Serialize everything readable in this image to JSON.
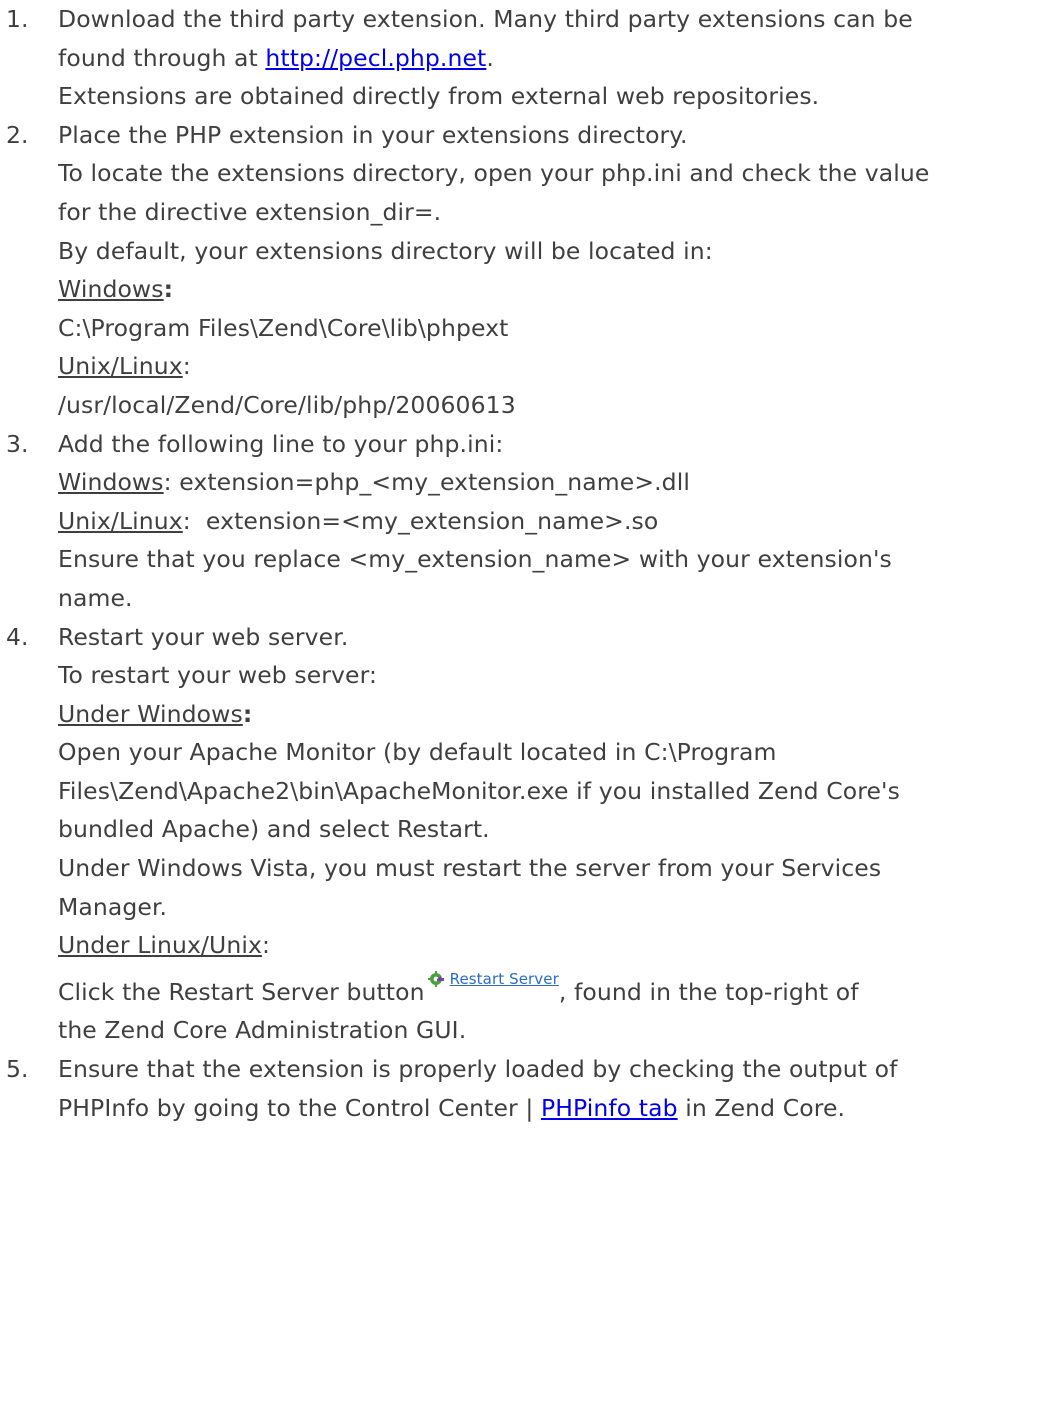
{
  "steps": [
    {
      "number": "1.",
      "line1_before": "Download the third party extension. Many third party extensions can be",
      "line2_before": "found through at ",
      "pecl_link": "http://pecl.php.net",
      "line2_after": ".",
      "line3": "Extensions are obtained directly from external web repositories."
    },
    {
      "number": "2.",
      "line1": "Place the PHP extension in your extensions directory.",
      "line2": "To locate the extensions directory, open your php.ini and check the value",
      "line3": "for the directive extension_dir=.",
      "line4": "By default, your extensions directory will be located in:",
      "windows_label": "Windows",
      "windows_colon": ":",
      "windows_path": "C:\\Program Files\\Zend\\Core\\lib\\phpext",
      "unix_label": "Unix/Linux",
      "unix_colon": ":",
      "unix_path": "/usr/local/Zend/Core/lib/php/20060613"
    },
    {
      "number": "3.",
      "line1": "Add the following line to your php.ini:",
      "windows_label": "Windows",
      "windows_value": ": extension=php_<my_extension_name>.dll",
      "unix_label": "Unix/Linux",
      "unix_value": ":  extension=<my_extension_name>.so",
      "line4": "Ensure that you replace <my_extension_name> with your extension's",
      "line5": "name."
    },
    {
      "number": "4.",
      "line1": "Restart your web server.",
      "line2": "To restart your web server:",
      "under_windows_label": "Under Windows",
      "under_windows_colon": ":",
      "apache_line1": "Open your Apache Monitor (by default located in C:\\Program",
      "apache_line2": "Files\\Zend\\Apache2\\bin\\ApacheMonitor.exe if you installed Zend Core's",
      "apache_line3": "bundled Apache) and select Restart.",
      "vista_line1": "Under Windows Vista, you must restart the server from your Services",
      "vista_line2": "Manager.",
      "under_linux_label": "Under Linux/Unix",
      "under_linux_colon": ":",
      "click_before": "Click the Restart Server button",
      "restart_button_label": "Restart Server",
      "click_after": ", found in the top-right of",
      "click_line2": "the Zend Core Administration GUI."
    },
    {
      "number": "5.",
      "line1": "Ensure that the extension is properly loaded by checking the output of",
      "line2_before": "PHPInfo by going to the Control Center | ",
      "phpinfo_link": "PHPinfo tab",
      "line2_after": " in Zend Core."
    }
  ],
  "icons": {
    "restart": "restart-server-icon"
  },
  "colors": {
    "text": "#3f3f3f",
    "link": "#0000ee",
    "button_link": "#2a6cc8"
  }
}
